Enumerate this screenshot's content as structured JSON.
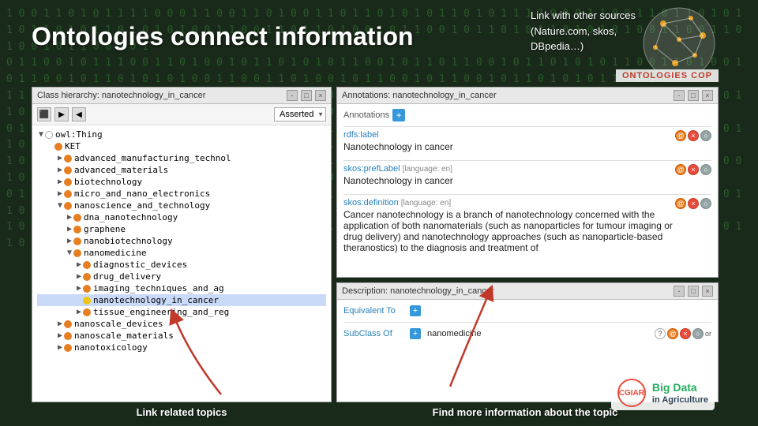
{
  "background": {
    "binary_text": "1 0 0 1 1 0 1 0 1 1 1 1 0 0 0 1 1 0 0 1 1 0 1 0 0 1 1 0 1 1 0 1 0 1 0 1 1 0 1 0 1 1 1 1 0 0 0 1 1 0 0 1 1 0 1 1 0 1 0 1 1 0 1 1 0 1 0 1 1 0 1 0 1 0 1 0 0 1 1 0 0 1 1 0 1 1 0 1 0 0 1 0 1 1 0 0 1 0 1 1 0 1 0 1 1 0 1 0 1 0 1 0 0 1 1 0 0 1 1 0 1 0 0 1 0 1 1 0 0 1 0 1 1 0 1 0 1 1 0 1 0 1 0 1 1 0 1 0 1 0 1 0 0 1 1 0 0 1 1 0 1 0 0 1 0 1 1 0 0 1 0 1 1 0 1 0 1 1 0 1 0 1 0 1"
  },
  "header": {
    "title": "Ontologies connect information",
    "top_right": {
      "line1": "Link with other sources",
      "line2": "(Nature.com, skos,",
      "line3": "DBpedia…)"
    },
    "banner": "ONTOLOGIES COP"
  },
  "left_panel": {
    "title": "Class hierarchy: nanotechnology_in_cancer",
    "toolbar_buttons": [
      "⬛",
      "▶",
      "◀"
    ],
    "dropdown_label": "Asserted",
    "tree": [
      {
        "indent": 0,
        "toggle": "▼",
        "dot": "white",
        "label": "owl:Thing",
        "selected": false
      },
      {
        "indent": 1,
        "toggle": "",
        "dot": "orange",
        "label": "KET",
        "selected": false
      },
      {
        "indent": 2,
        "toggle": "▶",
        "dot": "orange",
        "label": "advanced_manufacturing_technol",
        "selected": false
      },
      {
        "indent": 2,
        "toggle": "▶",
        "dot": "orange",
        "label": "advanced_materials",
        "selected": false
      },
      {
        "indent": 2,
        "toggle": "▶",
        "dot": "orange",
        "label": "biotechnology",
        "selected": false
      },
      {
        "indent": 2,
        "toggle": "▶",
        "dot": "orange",
        "label": "micro_and_nano_electronics",
        "selected": false
      },
      {
        "indent": 2,
        "toggle": "▼",
        "dot": "orange",
        "label": "nanoscience_and_technology",
        "selected": false
      },
      {
        "indent": 3,
        "toggle": "▶",
        "dot": "orange",
        "label": "dna_nanotechnology",
        "selected": false
      },
      {
        "indent": 3,
        "toggle": "▶",
        "dot": "orange",
        "label": "graphene",
        "selected": false
      },
      {
        "indent": 3,
        "toggle": "▶",
        "dot": "orange",
        "label": "nanobiotechnology",
        "selected": false
      },
      {
        "indent": 3,
        "toggle": "▼",
        "dot": "orange",
        "label": "nanomedicine",
        "selected": false
      },
      {
        "indent": 4,
        "toggle": "▶",
        "dot": "orange",
        "label": "diagnostic_devices",
        "selected": false
      },
      {
        "indent": 4,
        "toggle": "▶",
        "dot": "orange",
        "label": "drug_delivery",
        "selected": false
      },
      {
        "indent": 4,
        "toggle": "▶",
        "dot": "orange",
        "label": "imaging_techniques_and_ag",
        "selected": false
      },
      {
        "indent": 4,
        "toggle": "",
        "dot": "yellow",
        "label": "nanotechnology_in_cancer",
        "selected": true
      },
      {
        "indent": 4,
        "toggle": "▶",
        "dot": "orange",
        "label": "tissue_engineering_and_reg",
        "selected": false
      },
      {
        "indent": 2,
        "toggle": "▶",
        "dot": "orange",
        "label": "nanoscale_devices",
        "selected": false
      },
      {
        "indent": 2,
        "toggle": "▶",
        "dot": "orange",
        "label": "nanoscale_materials",
        "selected": false
      },
      {
        "indent": 2,
        "toggle": "▶",
        "dot": "orange",
        "label": "nanotoxicology",
        "selected": false
      }
    ]
  },
  "annotations_panel": {
    "title": "Annotations: nanotechnology_in_cancer",
    "add_button": "+",
    "sections": [
      {
        "property": "rdfs:label",
        "lang_tag": "",
        "value": "Nanotechnology in cancer"
      },
      {
        "property": "skos:prefLabel",
        "lang_tag": "[language: en]",
        "value": "Nanotechnology in cancer"
      },
      {
        "property": "skos:definition",
        "lang_tag": "[language: en]",
        "value": "Cancer nanotechnology is a branch of nanotechnology concerned with the application of both nanomaterials (such as nanoparticles for tumour imaging or drug delivery) and nanotechnology approaches (such as nanoparticle-based theranostics) to the diagnosis and treatment of"
      }
    ]
  },
  "description_panel": {
    "title": "Description: nanotechnology_in_cancer",
    "rows": [
      {
        "label": "Equivalent To",
        "has_add": true,
        "value": ""
      },
      {
        "label": "SubClass Of",
        "has_add": true,
        "value": "nanomedicine"
      }
    ]
  },
  "bottom_labels": {
    "link_topics": "Link related topics",
    "find_more": "Find more information about the topic"
  },
  "logo": {
    "cgiar": "CGIAR",
    "big_data_line1": "Big Data",
    "big_data_line2": "in Agriculture"
  },
  "colors": {
    "dot_orange": "#e67e22",
    "dot_yellow": "#f1c40f",
    "accent_blue": "#2980b9",
    "selected_bg": "#c8daf8"
  }
}
